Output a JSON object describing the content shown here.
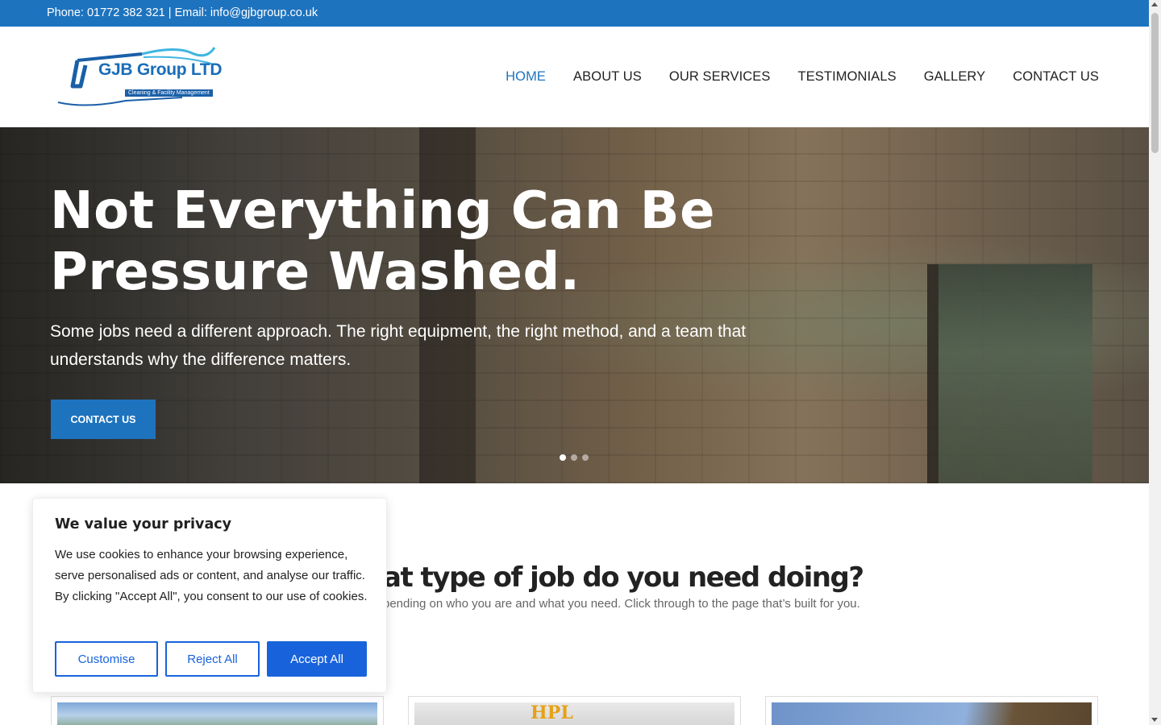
{
  "topbar": {
    "contact": "Phone: 01772 382 321 | Email: info@gjbgroup.co.uk"
  },
  "logo": {
    "name": "GJB Group LTD",
    "tagline": "Cleaning & Facility Management"
  },
  "nav": {
    "items": [
      "HOME",
      "ABOUT US",
      "OUR SERVICES",
      "TESTIMONIALS",
      "GALLERY",
      "CONTACT US"
    ],
    "active": "HOME"
  },
  "hero": {
    "heading_line1": "Not Everything Can Be",
    "heading_line2": "Pressure Washed.",
    "body": "Some jobs need a different approach. The right equipment, the right method, and a team that understands why the difference matters.",
    "cta": "CONTACT US",
    "slide_count": 3,
    "active_slide": 1
  },
  "section": {
    "title_visible": "at type of job do you need doing?",
    "subtitle_visible": "pending on who you are and what you need. Click through to the page that’s built for you."
  },
  "cards": [
    {
      "image_label": ""
    },
    {
      "image_label": "HPL"
    },
    {
      "image_label": ""
    }
  ],
  "cookie": {
    "title": "We value your privacy",
    "body": "We use cookies to enhance your browsing experience, serve personalised ads or content, and analyse our traffic. By clicking \"Accept All\", you consent to our use of cookies.",
    "customise": "Customise",
    "reject": "Reject All",
    "accept": "Accept All"
  },
  "colors": {
    "brand": "#1e73be",
    "cookie_accent": "#1863dc"
  }
}
